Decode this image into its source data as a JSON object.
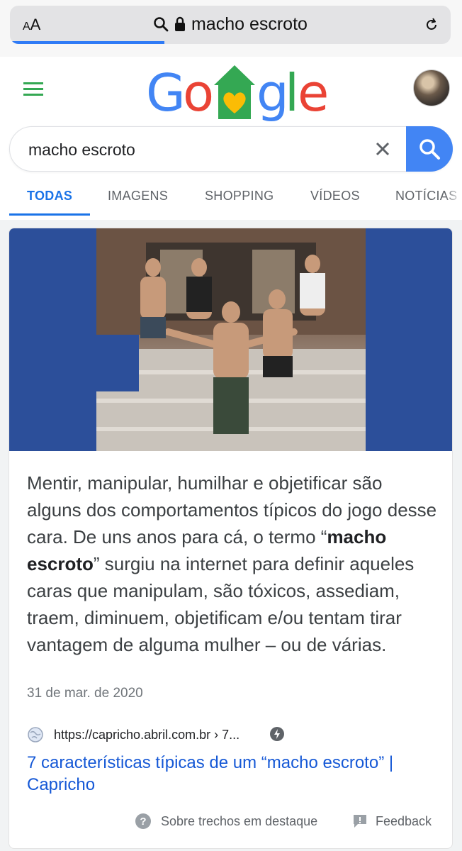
{
  "browser": {
    "text_size_label": "AA",
    "url_text": "macho escroto",
    "load_progress": 0.35
  },
  "google": {
    "logo_letters": [
      "G",
      "o",
      "",
      "g",
      "l",
      "e"
    ],
    "search_value": "macho escroto",
    "tabs": [
      {
        "label": "TODAS",
        "active": true
      },
      {
        "label": "IMAGENS",
        "active": false
      },
      {
        "label": "SHOPPING",
        "active": false
      },
      {
        "label": "VÍDEOS",
        "active": false
      },
      {
        "label": "NOTÍCIAS",
        "active": false
      }
    ]
  },
  "featured": {
    "snippet_before": "Mentir, manipular, humilhar e objetificar são alguns dos comportamentos típicos do jogo desse cara. De uns anos para cá, o termo “",
    "snippet_bold": "macho escroto",
    "snippet_after": "” surgiu na internet para definir aqueles caras que manipulam, são tóxicos, assediam, traem, diminuem, objetificam e/ou tentam tirar vantagem de alguma mulher – ou de várias.",
    "date": "31 de mar. de 2020",
    "source_url": "https://capricho.abril.com.br › 7...",
    "title": "7 características típicas de um “macho escroto” | Capricho",
    "about_label": "Sobre trechos em destaque",
    "feedback_label": "Feedback"
  },
  "colors": {
    "google_blue": "#4285f4",
    "google_red": "#ea4335",
    "google_yellow": "#fbbc05",
    "google_green": "#34a853",
    "link_blue": "#1558d6",
    "active_tab": "#1a73e8"
  }
}
